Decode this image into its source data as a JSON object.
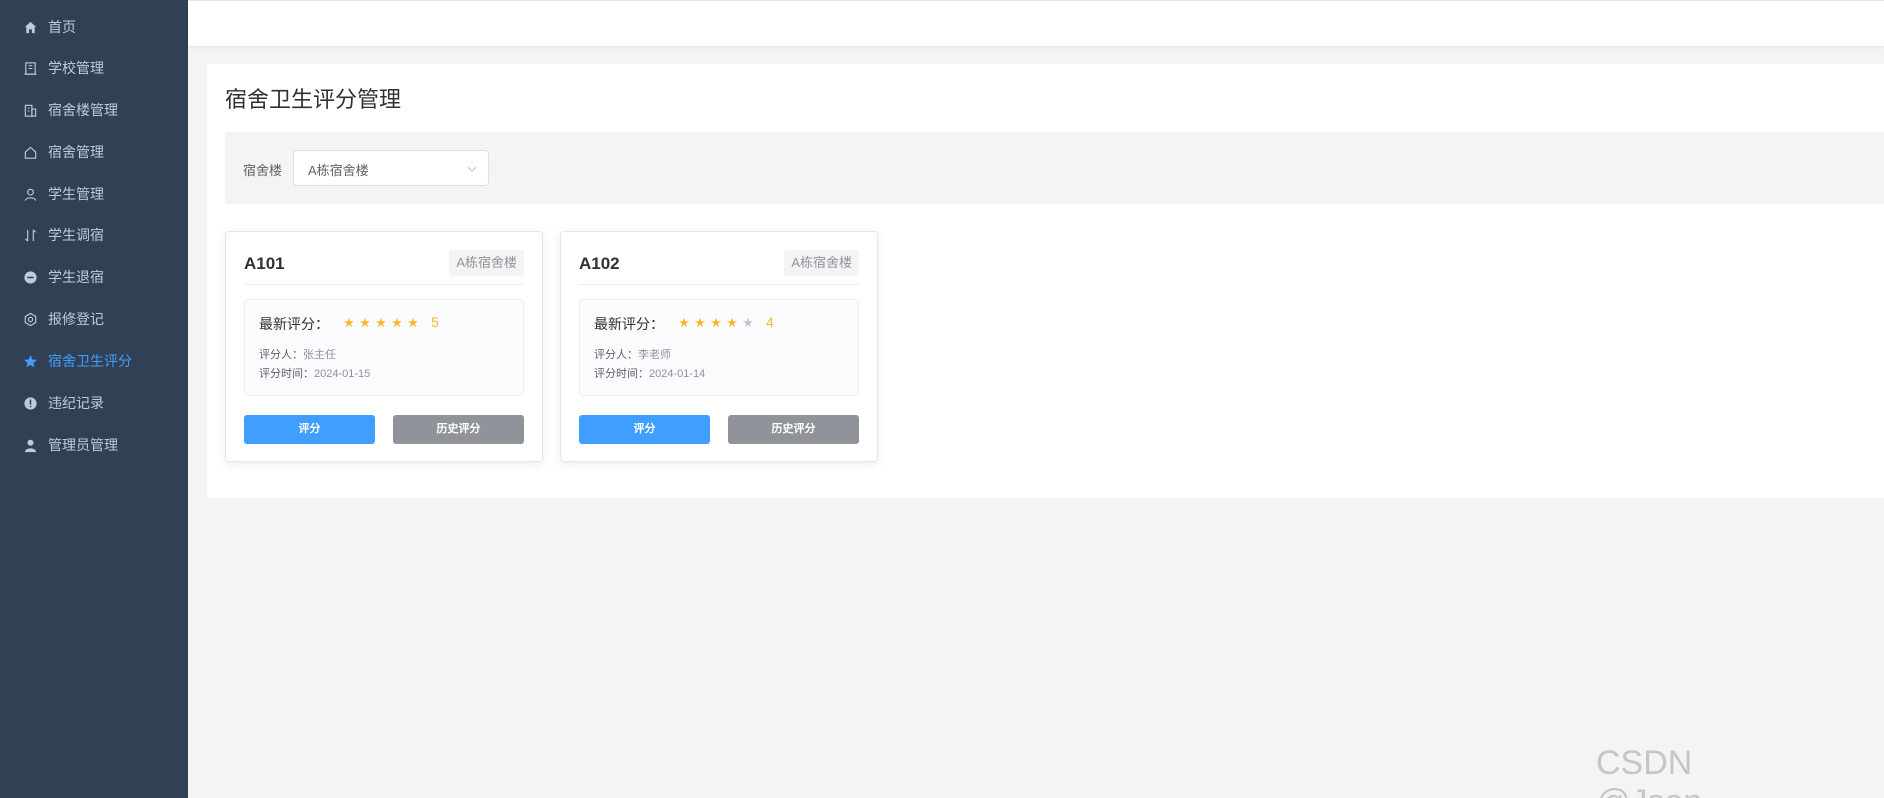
{
  "sidebar": {
    "items": [
      {
        "label": "首页",
        "icon": "home-icon"
      },
      {
        "label": "学校管理",
        "icon": "school-icon"
      },
      {
        "label": "宿舍楼管理",
        "icon": "building-icon"
      },
      {
        "label": "宿舍管理",
        "icon": "house-icon"
      },
      {
        "label": "学生管理",
        "icon": "user-icon"
      },
      {
        "label": "学生调宿",
        "icon": "transfer-icon"
      },
      {
        "label": "学生退宿",
        "icon": "remove-icon"
      },
      {
        "label": "报修登记",
        "icon": "settings-icon"
      },
      {
        "label": "宿舍卫生评分",
        "icon": "star-icon",
        "active": true
      },
      {
        "label": "违纪记录",
        "icon": "warning-icon"
      },
      {
        "label": "管理员管理",
        "icon": "admin-icon"
      }
    ]
  },
  "page": {
    "title": "宿舍卫生评分管理"
  },
  "filter": {
    "label": "宿舍楼",
    "selected": "A栋宿舍楼"
  },
  "rooms": [
    {
      "name": "A101",
      "building": "A栋宿舍楼",
      "score_label": "最新评分：",
      "score": 5,
      "score_text": "5",
      "rater_label": "评分人：",
      "rater": "张主任",
      "time_label": "评分时间：",
      "time": "2024-01-15",
      "rate_btn": "评分",
      "history_btn": "历史评分"
    },
    {
      "name": "A102",
      "building": "A栋宿舍楼",
      "score_label": "最新评分：",
      "score": 4,
      "score_text": "4",
      "rater_label": "评分人：",
      "rater": "李老师",
      "time_label": "评分时间：",
      "time": "2024-01-14",
      "rate_btn": "评分",
      "history_btn": "历史评分"
    }
  ],
  "colors": {
    "sidebar_bg": "#304156",
    "accent": "#409eff",
    "star": "#f7ba2a",
    "gray_button": "#909399"
  },
  "watermark": "CSDN @Json_____"
}
